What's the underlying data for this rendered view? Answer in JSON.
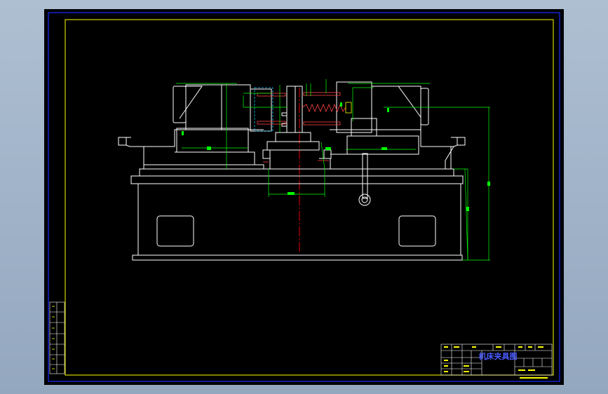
{
  "app": {
    "background_color": "#9fb3c8",
    "canvas_color": "#000000"
  },
  "sheet": {
    "outer_border_color": "#1a2cff",
    "inner_border_color": "#ffff00"
  },
  "drawing": {
    "subject": "vise-assembly",
    "outline_color": "#ffffff",
    "dimension_color": "#00ff00",
    "centerline_color": "#ff0000",
    "hidden_line_color": "#00c8ff"
  },
  "title_block": {
    "drawing_title": "机床夹具图",
    "title_color": "#4a5cff"
  }
}
